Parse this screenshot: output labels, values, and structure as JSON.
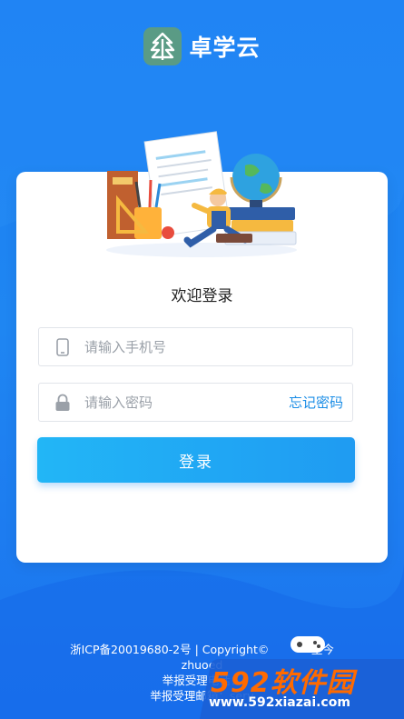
{
  "header": {
    "app_name": "卓学云"
  },
  "login": {
    "welcome": "欢迎登录",
    "phone_placeholder": "请输入手机号",
    "password_placeholder": "请输入密码",
    "forgot_label": "忘记密码",
    "submit_label": "登录"
  },
  "footer": {
    "line1": "浙ICP备20019680-2号 | Copyright©",
    "line1_tail": "-至今",
    "line2": "zhuoed",
    "line3": "举报受理电话：",
    "line4": "举报受理邮箱：serv"
  },
  "watermark": {
    "brand": "592软件园",
    "url": "www.592xiazai.com"
  },
  "colors": {
    "primary": "#1f9bf2",
    "background": "#1b7ff3",
    "logo_green": "#5a9b85",
    "watermark_orange": "#ff6a00"
  }
}
